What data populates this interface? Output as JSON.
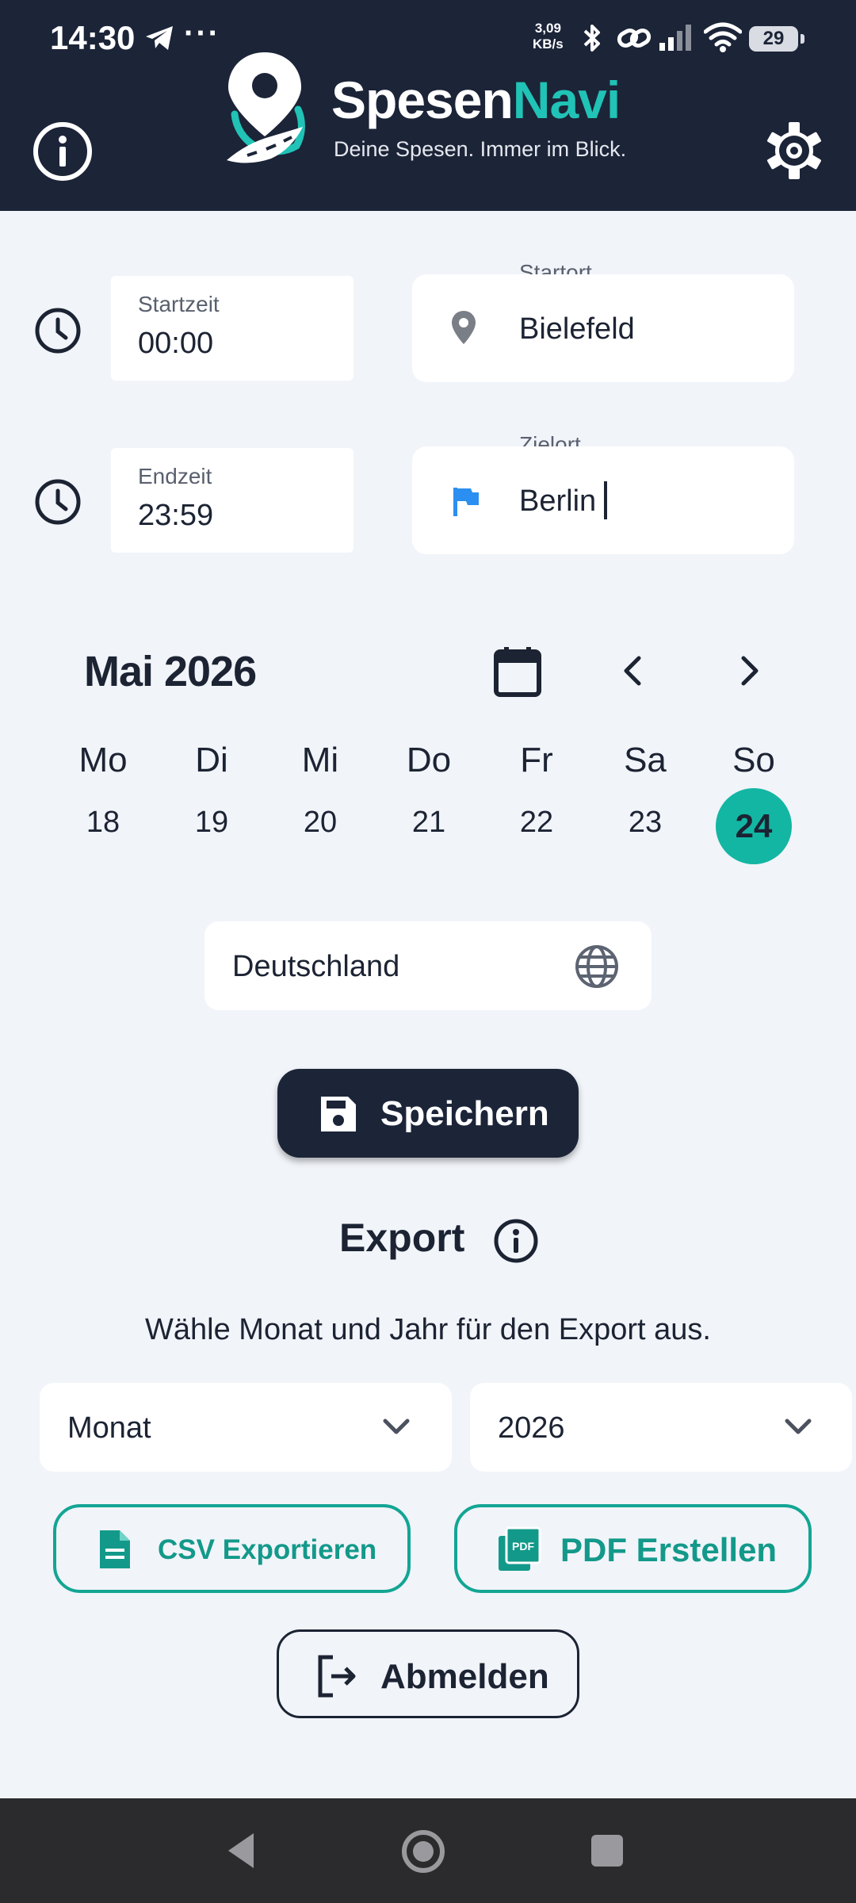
{
  "status_bar": {
    "time": "14:30",
    "more": "···",
    "speed_value": "3,09",
    "speed_unit": "KB/s",
    "battery": "29"
  },
  "header": {
    "brand_first": "Spesen",
    "brand_second": "Navi",
    "tagline": "Deine Spesen. Immer im Blick."
  },
  "times": {
    "start_label": "Startzeit",
    "start_value": "00:00",
    "end_label": "Endzeit",
    "end_value": "23:59"
  },
  "locations": {
    "start_label": "Startort",
    "start_value": "Bielefeld",
    "dest_label": "Zielort",
    "dest_value": "Berlin"
  },
  "calendar": {
    "month_title": "Mai 2026",
    "days": [
      {
        "name": "Mo",
        "num": "18"
      },
      {
        "name": "Di",
        "num": "19"
      },
      {
        "name": "Mi",
        "num": "20"
      },
      {
        "name": "Do",
        "num": "21"
      },
      {
        "name": "Fr",
        "num": "22"
      },
      {
        "name": "Sa",
        "num": "23"
      },
      {
        "name": "So",
        "num": "24"
      }
    ],
    "selected_day": "24"
  },
  "country": {
    "value": "Deutschland"
  },
  "actions": {
    "save_label": "Speichern"
  },
  "export": {
    "title": "Export",
    "description": "Wähle Monat und Jahr für den Export aus.",
    "month_select": "Monat",
    "year_select": "2026",
    "csv_label": "CSV Exportieren",
    "pdf_label": "PDF Erstellen",
    "logout_label": "Abmelden",
    "pdf_badge": "PDF"
  },
  "colors": {
    "header_bg": "#1c2438",
    "accent": "#13b6a3",
    "background": "#f1f4f9",
    "flag": "#2a8ff0"
  }
}
